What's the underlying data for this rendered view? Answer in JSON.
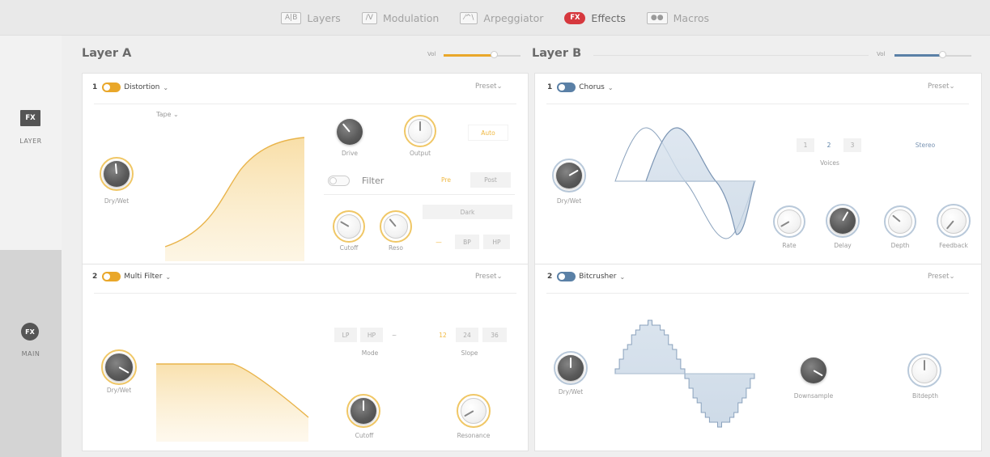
{
  "topnav": {
    "tabs": [
      {
        "icon_text": "A|B",
        "label": "Layers"
      },
      {
        "icon_text": "/V",
        "label": "Modulation"
      },
      {
        "icon_text": "⁄^\\",
        "label": "Arpeggiator"
      },
      {
        "icon_text": "FX",
        "label": "Effects",
        "active": true
      },
      {
        "icon_text": "●●",
        "label": "Macros"
      }
    ]
  },
  "sidebar": {
    "layer": {
      "icon_text": "FX",
      "label": "LAYER"
    },
    "main": {
      "icon_text": "FX",
      "label": "MAIN"
    }
  },
  "colors": {
    "accent_orange": "#e9a72a",
    "accent_blue": "#5a80a6",
    "fx_red": "#d6383e"
  },
  "layerA": {
    "title": "Layer A",
    "vol_label": "Vol",
    "vol_value": 0.7,
    "slot1": {
      "number": "1",
      "name": "Distortion",
      "preset": "Preset",
      "mode": "Tape",
      "knob_drywet": "Dry/Wet",
      "knob_drive": "Drive",
      "knob_output": "Output",
      "auto": "Auto",
      "filter_label": "Filter",
      "pre": "Pre",
      "post": "Post",
      "dark": "Dark",
      "knob_cutoff": "Cutoff",
      "knob_reso": "Reso",
      "filter_types": [
        "—",
        "BP",
        "HP"
      ]
    },
    "slot2": {
      "number": "2",
      "name": "Multi Filter",
      "preset": "Preset",
      "knob_drywet": "Dry/Wet",
      "mode_label": "Mode",
      "mode_opts": [
        "LP",
        "HP",
        "~"
      ],
      "slope_label": "Slope",
      "slope_opts": [
        "12",
        "24",
        "36"
      ],
      "knob_cutoff": "Cutoff",
      "knob_resonance": "Resonance"
    }
  },
  "layerB": {
    "title": "Layer B",
    "vol_label": "Vol",
    "vol_value": 0.75,
    "slot1": {
      "number": "1",
      "name": "Chorus",
      "preset": "Preset",
      "knob_drywet": "Dry/Wet",
      "voices": [
        "1",
        "2",
        "3"
      ],
      "voices_label": "Voices",
      "stereo": "Stereo",
      "knob_rate": "Rate",
      "knob_delay": "Delay",
      "knob_depth": "Depth",
      "knob_feedback": "Feedback"
    },
    "slot2": {
      "number": "2",
      "name": "Bitcrusher",
      "preset": "Preset",
      "knob_drywet": "Dry/Wet",
      "knob_downsample": "Downsample",
      "knob_bitdepth": "Bitdepth"
    }
  }
}
